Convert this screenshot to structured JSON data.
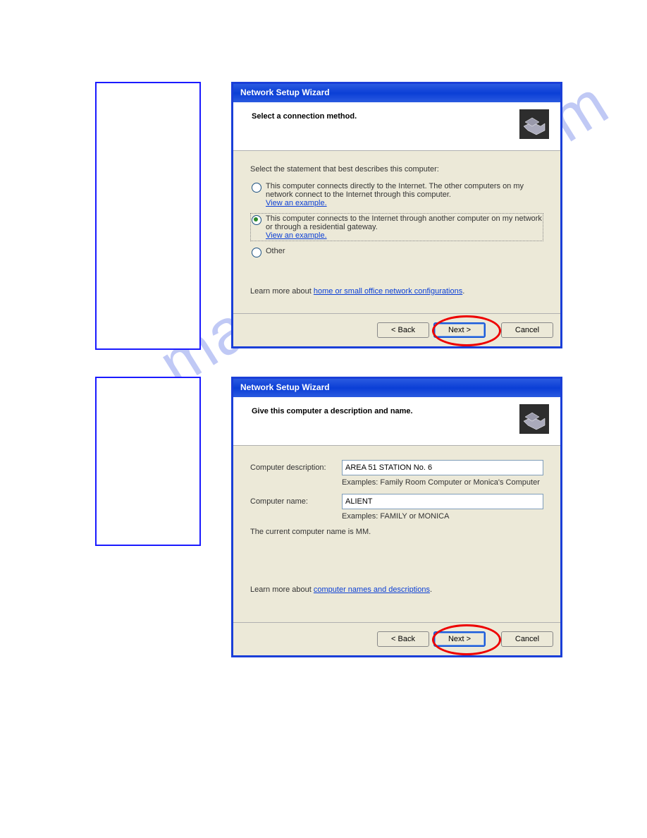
{
  "watermark": "manualshive.com",
  "wizard1": {
    "title": "Network Setup Wizard",
    "heading": "Select a connection method.",
    "instruction": "Select the statement that best describes this computer:",
    "option1_text": "This computer connects directly to the Internet. The other computers on my network connect to the Internet through this computer.",
    "option2_text": "This computer connects to the Internet through another computer on my network or through a residential gateway.",
    "option3_text": "Other",
    "view_example": "View an example.",
    "learn_more_prefix": "Learn more about ",
    "learn_more_link": "home or small office network configurations",
    "dot": ".",
    "back": "< Back",
    "next": "Next >",
    "cancel": "Cancel",
    "selected_option": 2
  },
  "wizard2": {
    "title": "Network Setup Wizard",
    "heading": "Give this computer a description and name.",
    "desc_label": "Computer description:",
    "desc_value": "AREA 51 STATION No. 6",
    "desc_example": "Examples: Family Room Computer or Monica's Computer",
    "name_label": "Computer name:",
    "name_value": "ALIENT",
    "name_example": "Examples: FAMILY or MONICA",
    "current": "The current computer name is MM.",
    "learn_more_prefix": "Learn more about ",
    "learn_more_link": "computer names and descriptions",
    "dot": ".",
    "back": "< Back",
    "next": "Next >",
    "cancel": "Cancel"
  }
}
